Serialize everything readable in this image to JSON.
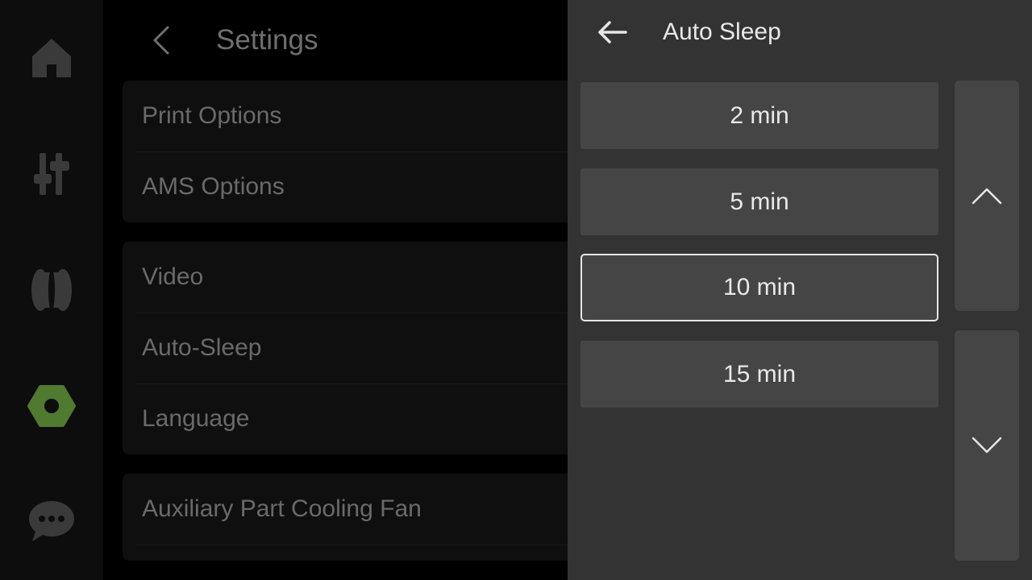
{
  "nav": {
    "items": [
      {
        "name": "home-icon",
        "active": false
      },
      {
        "name": "controls-icon",
        "active": false
      },
      {
        "name": "filament-icon",
        "active": false
      },
      {
        "name": "settings-nut-icon",
        "active": true
      },
      {
        "name": "chat-icon",
        "active": false
      }
    ],
    "active_color": "#4f7a2f",
    "inactive_color": "#3a3a3a"
  },
  "settings": {
    "title": "Settings",
    "groups": [
      {
        "items": [
          {
            "label": "Print Options"
          },
          {
            "label": "AMS Options"
          }
        ]
      },
      {
        "items": [
          {
            "label": "Video"
          },
          {
            "label": "Auto-Sleep"
          },
          {
            "label": "Language"
          }
        ]
      },
      {
        "items": [
          {
            "label": "Auxiliary Part Cooling Fan"
          }
        ]
      }
    ]
  },
  "panel": {
    "title": "Auto Sleep",
    "options": [
      {
        "label": "2 min",
        "selected": false
      },
      {
        "label": "5 min",
        "selected": false
      },
      {
        "label": "10 min",
        "selected": true
      },
      {
        "label": "15 min",
        "selected": false
      }
    ],
    "scroll_up_icon": "chevron-up-icon",
    "scroll_down_icon": "chevron-down-icon"
  },
  "colors": {
    "panel_bg": "#333333",
    "option_bg": "#454545",
    "selected_border": "#e6e6e6"
  }
}
